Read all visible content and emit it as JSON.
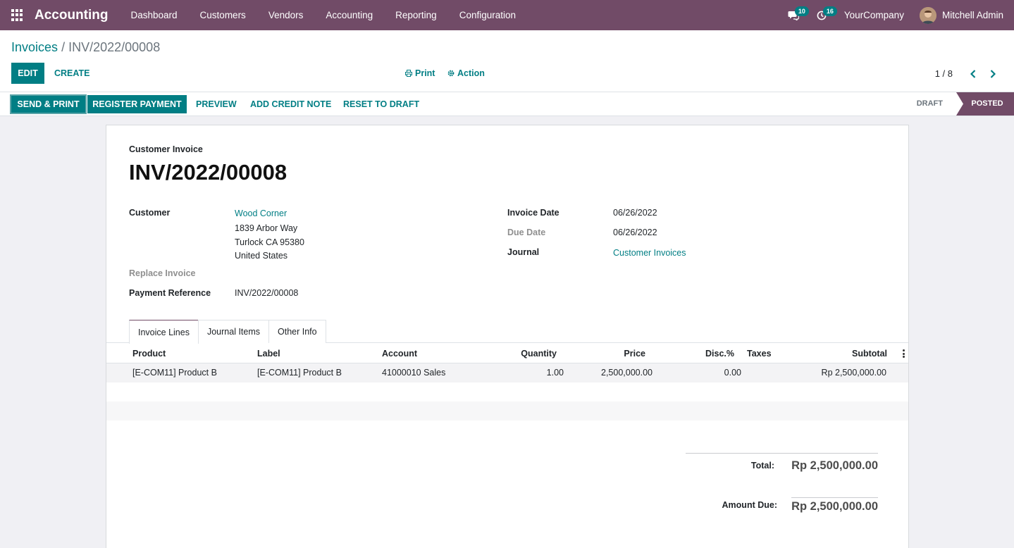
{
  "navbar": {
    "app_name": "Accounting",
    "menu": [
      "Dashboard",
      "Customers",
      "Vendors",
      "Accounting",
      "Reporting",
      "Configuration"
    ],
    "messages_count": "10",
    "activities_count": "16",
    "company": "YourCompany",
    "user": "Mitchell Admin"
  },
  "breadcrumb": {
    "parent": "Invoices",
    "separator": "/",
    "current": "INV/2022/00008"
  },
  "control": {
    "edit_label": "Edit",
    "create_label": "Create",
    "print_label": "Print",
    "action_label": "Action",
    "pager": "1 / 8"
  },
  "statusbar": {
    "buttons": [
      "Send & Print",
      "Register Payment",
      "Preview",
      "Add Credit Note",
      "Reset to Draft"
    ],
    "states": [
      "Draft",
      "Posted"
    ],
    "current_state": "Posted"
  },
  "invoice": {
    "doc_type": "Customer Invoice",
    "number": "INV/2022/00008",
    "customer_label": "Customer",
    "customer_name": "Wood Corner",
    "address_line1": "1839 Arbor Way",
    "address_line2": "Turlock CA 95380",
    "address_line3": "United States",
    "replace_label": "Replace Invoice",
    "payref_label": "Payment Reference",
    "payref_value": "INV/2022/00008",
    "invoice_date_label": "Invoice Date",
    "invoice_date": "06/26/2022",
    "due_date_label": "Due Date",
    "due_date": "06/26/2022",
    "journal_label": "Journal",
    "journal": "Customer Invoices"
  },
  "tabs": [
    "Invoice Lines",
    "Journal Items",
    "Other Info"
  ],
  "active_tab": "Invoice Lines",
  "table": {
    "columns": [
      "Product",
      "Label",
      "Account",
      "Quantity",
      "Price",
      "Disc.%",
      "Taxes",
      "Subtotal"
    ],
    "rows": [
      {
        "product": "[E-COM11] Product B",
        "label": "[E-COM11] Product B",
        "account": "41000010 Sales",
        "quantity": "1.00",
        "price": "2,500,000.00",
        "discount": "0.00",
        "taxes": "",
        "subtotal": "Rp 2,500,000.00"
      }
    ]
  },
  "totals": {
    "total_label": "Total:",
    "total_value": "Rp 2,500,000.00",
    "due_label": "Amount Due:",
    "due_value": "Rp 2,500,000.00"
  },
  "colors": {
    "brand": "#714b67",
    "accent": "#017e84"
  }
}
